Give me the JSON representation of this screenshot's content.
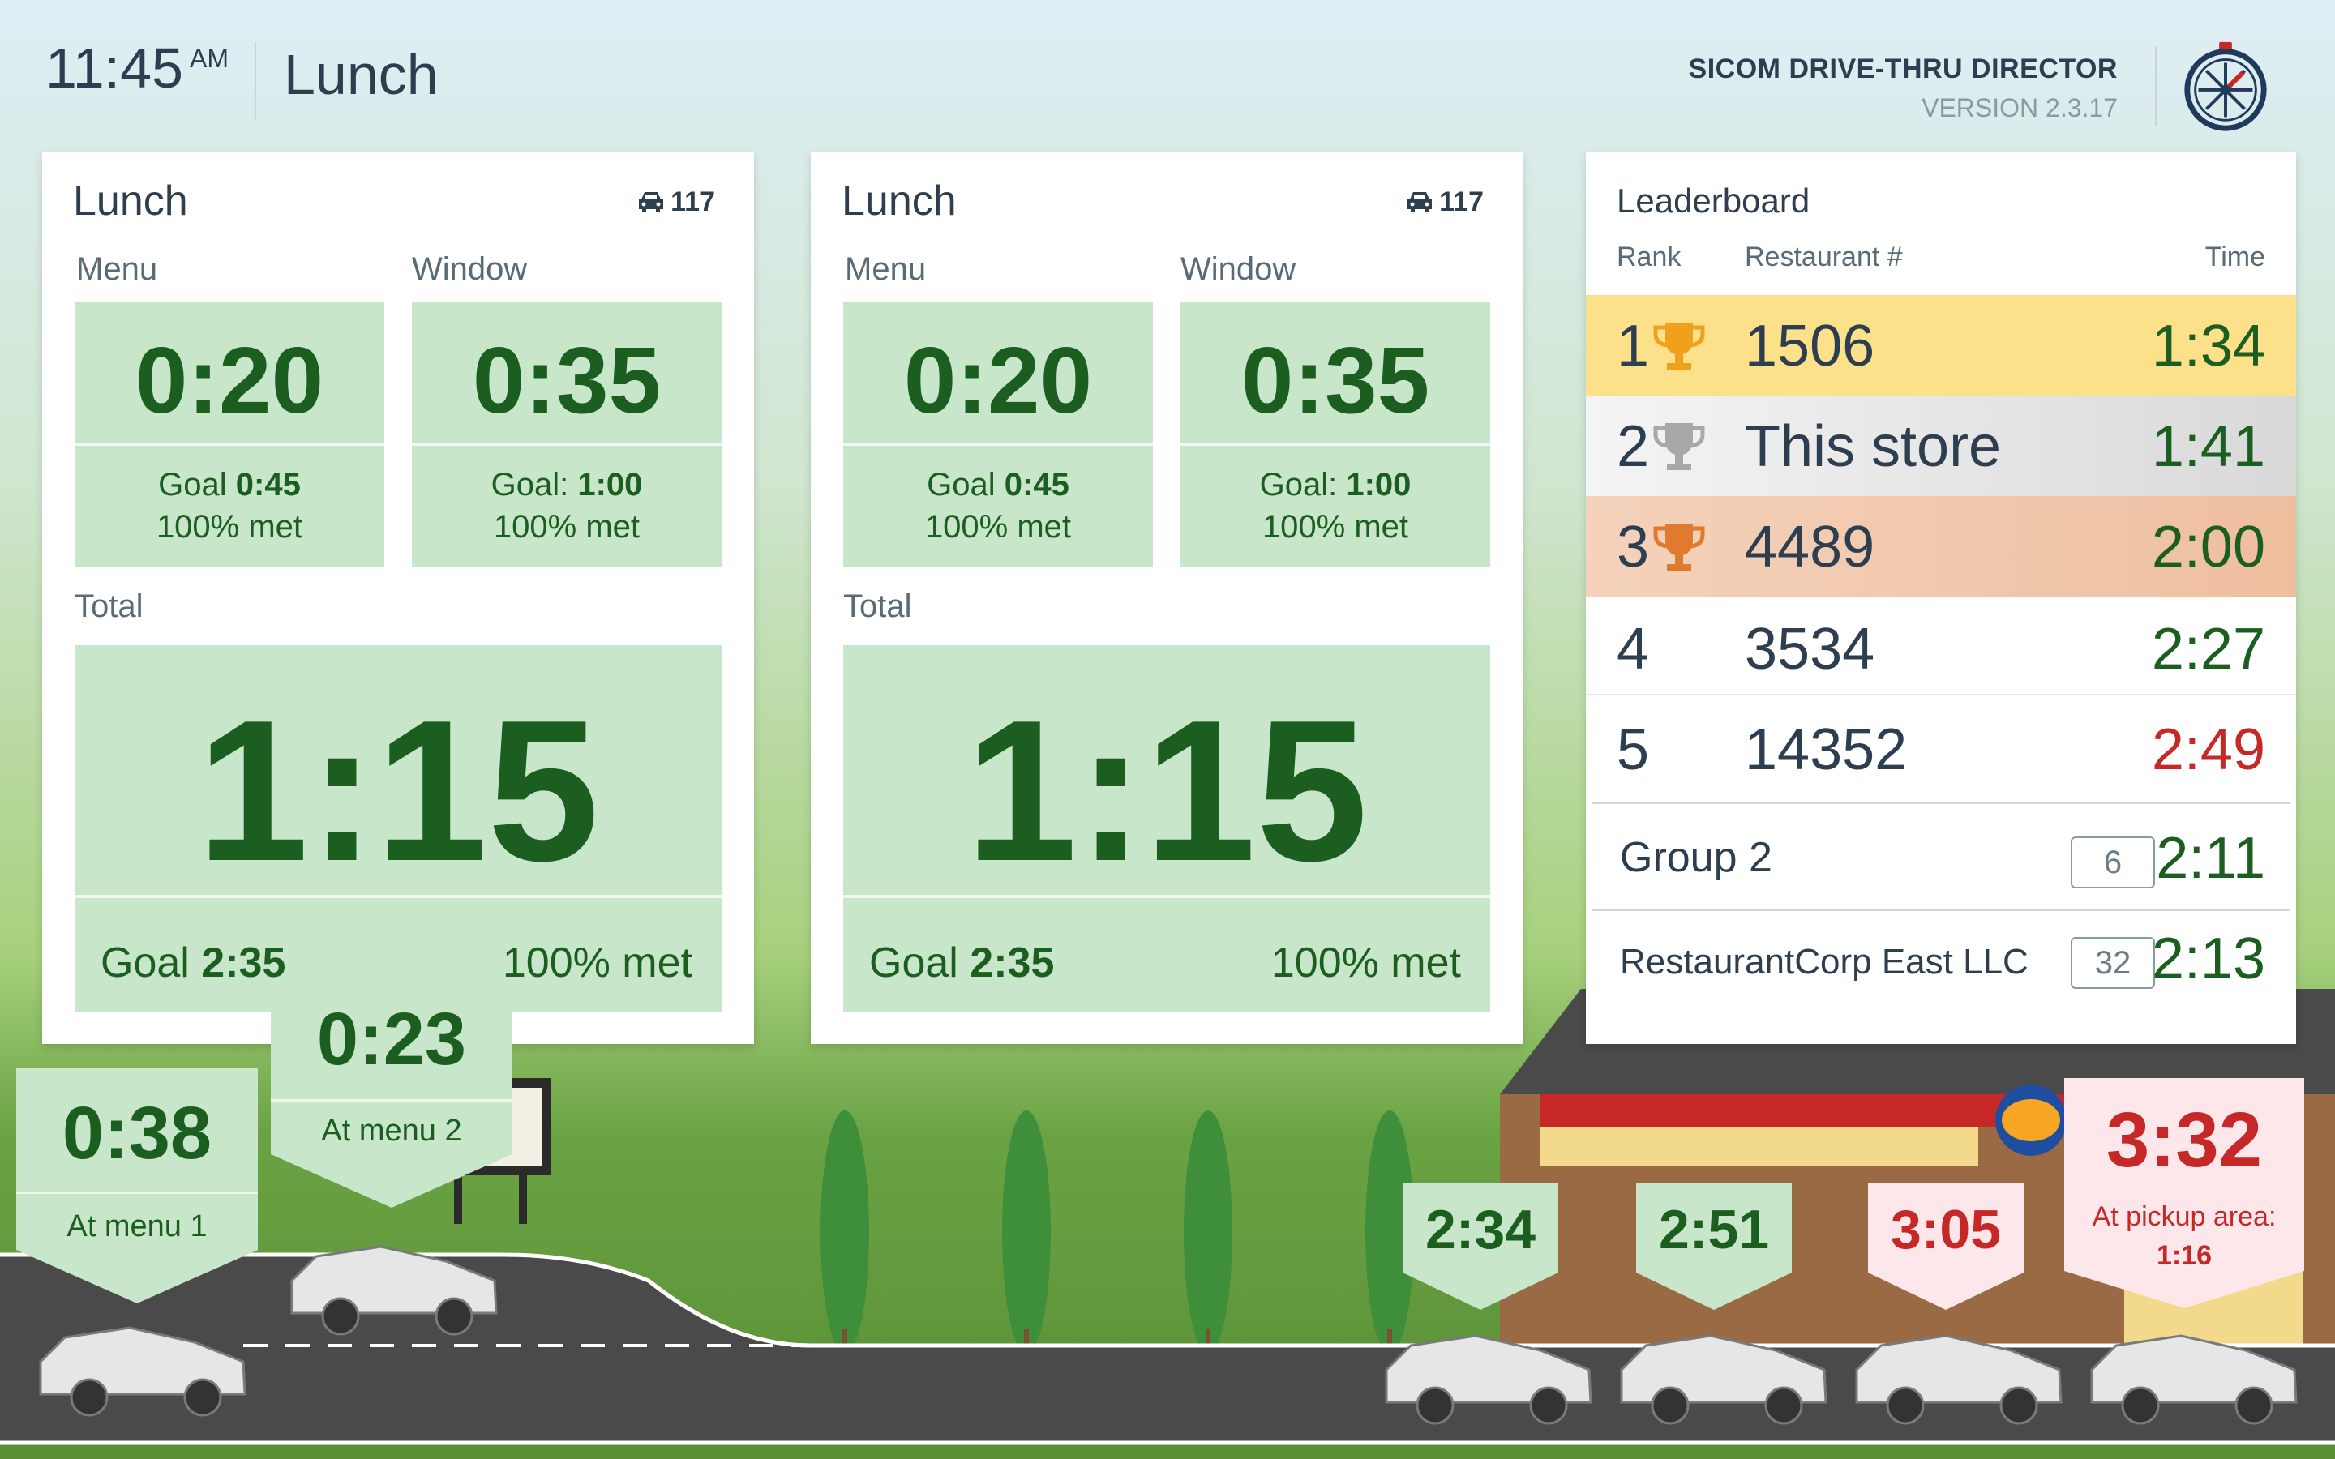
{
  "header": {
    "time": "11:45",
    "ampm": "AM",
    "daypart": "Lunch",
    "brand_name": "SICOM DRIVE-THRU DIRECTOR",
    "version": "VERSION 2.3.17"
  },
  "cards": [
    {
      "title": "Lunch",
      "car_count": "117",
      "menu_label": "Menu",
      "window_label": "Window",
      "menu_time": "0:20",
      "menu_goal_prefix": "Goal ",
      "menu_goal": "0:45",
      "menu_met": "100% met",
      "window_time": "0:35",
      "window_goal_prefix": "Goal: ",
      "window_goal": "1:00",
      "window_met": "100% met",
      "total_label": "Total",
      "total_time": "1:15",
      "total_goal_prefix": "Goal ",
      "total_goal": "2:35",
      "total_met": "100% met"
    },
    {
      "title": "Lunch",
      "car_count": "117",
      "menu_label": "Menu",
      "window_label": "Window",
      "menu_time": "0:20",
      "menu_goal_prefix": "Goal ",
      "menu_goal": "0:45",
      "menu_met": "100% met",
      "window_time": "0:35",
      "window_goal_prefix": "Goal: ",
      "window_goal": "1:00",
      "window_met": "100% met",
      "total_label": "Total",
      "total_time": "1:15",
      "total_goal_prefix": "Goal ",
      "total_goal": "2:35",
      "total_met": "100% met"
    }
  ],
  "leaderboard": {
    "title": "Leaderboard",
    "col_rank": "Rank",
    "col_restaurant": "Restaurant #",
    "col_time": "Time",
    "rows": [
      {
        "rank": "1",
        "store": "1506",
        "time": "1:34"
      },
      {
        "rank": "2",
        "store": "This store",
        "time": "1:41"
      },
      {
        "rank": "3",
        "store": "4489",
        "time": "2:00"
      },
      {
        "rank": "4",
        "store": "3534",
        "time": "2:27"
      },
      {
        "rank": "5",
        "store": "14352",
        "time": "2:49"
      }
    ],
    "groups": [
      {
        "name": "Group 2",
        "count": "6",
        "time": "2:11"
      },
      {
        "name": "RestaurantCorp East LLC",
        "count": "32",
        "time": "2:13"
      }
    ]
  },
  "lane": {
    "menu1": {
      "time": "0:38",
      "label": "At menu 1"
    },
    "menu2": {
      "time": "0:23",
      "label": "At menu 2"
    },
    "queue": [
      "2:34",
      "2:51",
      "3:05"
    ],
    "pickup": {
      "time": "3:32",
      "label": "At pickup area:",
      "sub": "1:16"
    }
  },
  "colors": {
    "good": "#1b5e20",
    "bad": "#c62828",
    "tile": "#c8e6c9",
    "gold": "#fde08a",
    "silver": "#e6e6e6",
    "bronze": "#f0c6a8"
  }
}
